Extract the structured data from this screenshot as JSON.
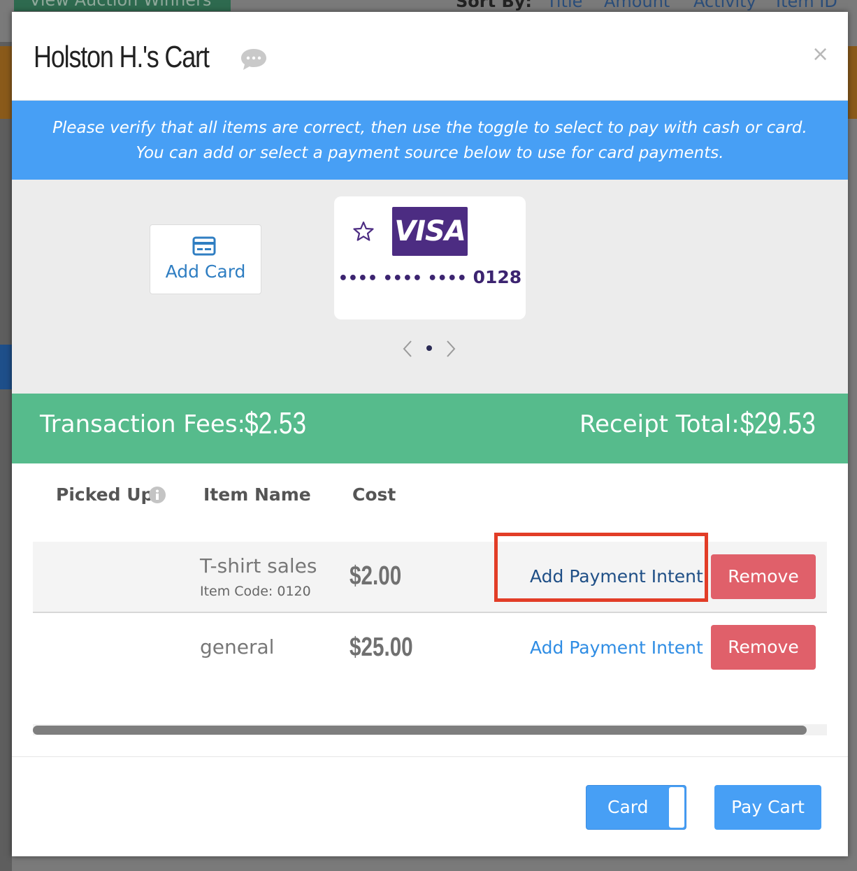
{
  "background": {
    "winners_button": "View Auction Winners",
    "sort_label": "Sort By:",
    "sort_options": [
      "Title",
      "Amount",
      "Activity",
      "Item ID"
    ]
  },
  "modal": {
    "title": "Holston H.'s Cart",
    "close": "×",
    "banner_line1": "Please verify that all items are correct, then use the toggle to select to pay with cash or card.",
    "banner_line2": "You can add or select a payment source below to use for card payments."
  },
  "payment": {
    "add_card_label": "Add Card",
    "card": {
      "brand": "VISA",
      "masked": "•••• •••• ••••",
      "last4": "0128"
    }
  },
  "totals": {
    "fees_label": "Transaction Fees:",
    "fees_value": "$2.53",
    "total_label": "Receipt Total:",
    "total_value": "$29.53"
  },
  "table": {
    "headers": {
      "picked_up": "Picked Up",
      "item_name": "Item Name",
      "cost": "Cost"
    },
    "rows": [
      {
        "name": "T-shirt sales",
        "code": "Item Code: 0120",
        "cost": "$2.00",
        "intent_label": "Add Payment Intent",
        "remove_label": "Remove"
      },
      {
        "name": "general",
        "code": "",
        "cost": "$25.00",
        "intent_label": "Add Payment Intent",
        "remove_label": "Remove"
      }
    ]
  },
  "footer": {
    "toggle_label": "Card",
    "pay_label": "Pay Cart"
  },
  "colors": {
    "banner": "#479ff5",
    "totals_bar": "#56bb8c",
    "remove": "#e0606a",
    "link": "#2f8de4",
    "highlight": "#e23d27",
    "visa": "#4c2c82"
  }
}
